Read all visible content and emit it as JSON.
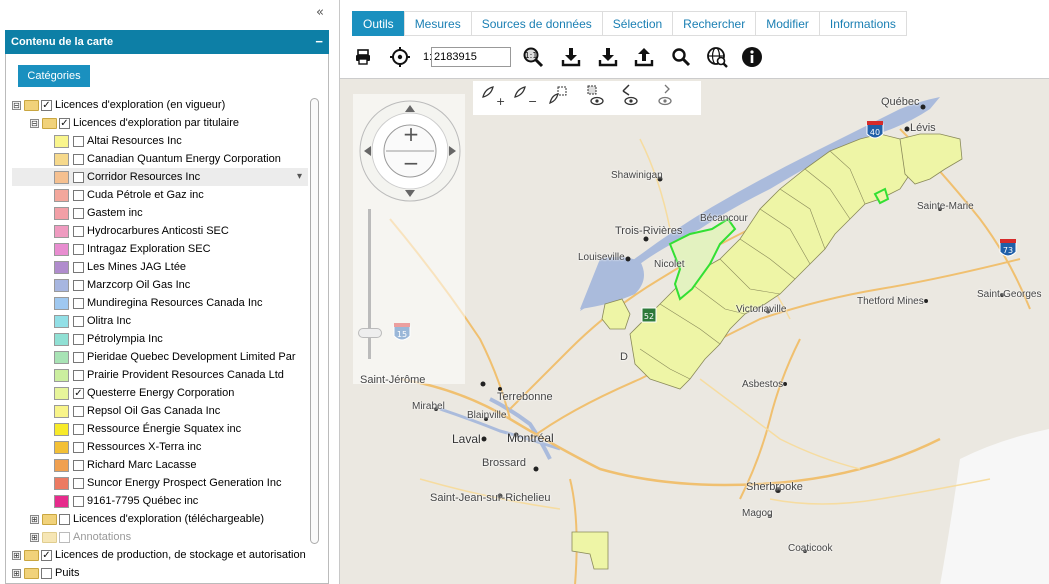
{
  "left_panel": {
    "collapse_icon": "«",
    "title": "Contenu de la carte",
    "minimize_icon": "−",
    "categories_tab": "Catégories",
    "tree": [
      {
        "expander": "⊟",
        "folder": true,
        "checked": true,
        "label": "Licences d'exploration (en vigueur)",
        "indent": 0
      },
      {
        "expander": "⊟",
        "folder": true,
        "checked": true,
        "label": "Licences d'exploration par titulaire",
        "indent": 1
      },
      {
        "swatch": "#f9f58d",
        "checked": false,
        "label": "Altai Resources Inc",
        "indent": 2
      },
      {
        "swatch": "#f6d98c",
        "checked": false,
        "label": "Canadian Quantum Energy Corporation",
        "indent": 2
      },
      {
        "swatch": "#f5c090",
        "checked": false,
        "label": "Corridor Resources Inc",
        "indent": 2,
        "highlight": true,
        "menu": "▾"
      },
      {
        "swatch": "#f3a79c",
        "checked": false,
        "label": "Cuda Pétrole et Gaz inc",
        "indent": 2
      },
      {
        "swatch": "#f29fa6",
        "checked": false,
        "label": "Gastem inc",
        "indent": 2
      },
      {
        "swatch": "#ef9bc0",
        "checked": false,
        "label": "Hydrocarbures Anticosti SEC",
        "indent": 2
      },
      {
        "swatch": "#e88dd0",
        "checked": false,
        "label": "Intragaz Exploration SEC",
        "indent": 2
      },
      {
        "swatch": "#b08ccd",
        "checked": false,
        "label": "Les Mines JAG Ltée",
        "indent": 2
      },
      {
        "swatch": "#a7b6e0",
        "checked": false,
        "label": "Marzcorp Oil Gas Inc",
        "indent": 2
      },
      {
        "swatch": "#9fc8f0",
        "checked": false,
        "label": "Mundiregina Resources Canada Inc",
        "indent": 2
      },
      {
        "swatch": "#92dfe6",
        "checked": false,
        "label": "Olitra Inc",
        "indent": 2
      },
      {
        "swatch": "#90e0d4",
        "checked": false,
        "label": "Pétrolympia Inc",
        "indent": 2
      },
      {
        "swatch": "#a8e3b5",
        "checked": false,
        "label": "Pieridae Quebec Development Limited Par",
        "indent": 2
      },
      {
        "swatch": "#cbee9f",
        "checked": false,
        "label": "Prairie Provident Resources Canada Ltd",
        "indent": 2
      },
      {
        "swatch": "#e7f59a",
        "checked": true,
        "label": "Questerre Energy Corporation",
        "indent": 2
      },
      {
        "swatch": "#f8f48a",
        "checked": false,
        "label": "Repsol Oil Gas Canada Inc",
        "indent": 2
      },
      {
        "swatch": "#f7ea2a",
        "checked": false,
        "label": "Ressource Énergie Squatex inc",
        "indent": 2
      },
      {
        "swatch": "#f3c036",
        "checked": false,
        "label": "Ressources X-Terra inc",
        "indent": 2
      },
      {
        "swatch": "#f0a050",
        "checked": false,
        "label": "Richard Marc Lacasse",
        "indent": 2
      },
      {
        "swatch": "#ec7a62",
        "checked": false,
        "label": "Suncor Energy Prospect Generation Inc",
        "indent": 2
      },
      {
        "swatch": "#e62b8c",
        "checked": false,
        "label": "9161-7795 Québec inc",
        "indent": 2
      },
      {
        "expander": "⊞",
        "folder": true,
        "checked": false,
        "label": "Licences d'exploration (téléchargeable)",
        "indent": 1
      },
      {
        "expander": "⊞",
        "folder": true,
        "dim": true,
        "checked": false,
        "label": "Annotations",
        "indent": 1,
        "gray": true
      },
      {
        "expander": "⊞",
        "folder": true,
        "checked": true,
        "label": "Licences de production, de stockage et autorisation",
        "indent": 0
      },
      {
        "expander": "⊞",
        "folder": true,
        "checked": false,
        "label": "Puits",
        "indent": 0
      }
    ]
  },
  "tabs": [
    {
      "label": "Outils",
      "active": true
    },
    {
      "label": "Mesures"
    },
    {
      "label": "Sources de données"
    },
    {
      "label": "Sélection"
    },
    {
      "label": "Rechercher"
    },
    {
      "label": "Modifier"
    },
    {
      "label": "Informations"
    }
  ],
  "toolbar": {
    "icons": [
      "printer-icon",
      "locate-icon",
      "zoom-scale-icon",
      "download-icon",
      "download-alt-icon",
      "upload-icon",
      "search-icon",
      "globe-search-icon",
      "info-icon"
    ],
    "scale_prefix": "1:",
    "scale_value": "2183915"
  },
  "map": {
    "zoom_plus": "+",
    "zoom_minus": "−",
    "cities": [
      {
        "name": "Québec",
        "cls": "mid"
      },
      {
        "name": "Lévis",
        "cls": "mid"
      },
      {
        "name": "Shawinigan",
        "cls": ""
      },
      {
        "name": "Bécancour",
        "cls": ""
      },
      {
        "name": "Sainte-Marie",
        "cls": ""
      },
      {
        "name": "Trois-Rivières",
        "cls": "mid"
      },
      {
        "name": "Louiseville",
        "cls": ""
      },
      {
        "name": "Nicolet",
        "cls": ""
      },
      {
        "name": "Victoriaville",
        "cls": ""
      },
      {
        "name": "Thetford Mines",
        "cls": ""
      },
      {
        "name": "Saint-Georges",
        "cls": ""
      },
      {
        "name": "D",
        "cls": "mid"
      },
      {
        "name": "Saint-Jérôme",
        "cls": "mid"
      },
      {
        "name": "Asbestos",
        "cls": ""
      },
      {
        "name": "Terrebonne",
        "cls": "mid"
      },
      {
        "name": "Mirabel",
        "cls": ""
      },
      {
        "name": "Blainville",
        "cls": ""
      },
      {
        "name": "Laval",
        "cls": "big"
      },
      {
        "name": "Montréal",
        "cls": "big"
      },
      {
        "name": "Brossard",
        "cls": "mid"
      },
      {
        "name": "Sherbrooke",
        "cls": "mid"
      },
      {
        "name": "Magog",
        "cls": ""
      },
      {
        "name": "Saint-Jean-sur-Richelieu",
        "cls": "mid"
      },
      {
        "name": "Coaticook",
        "cls": ""
      }
    ],
    "shields": [
      {
        "num": "40"
      },
      {
        "num": "73"
      },
      {
        "num": "15"
      },
      {
        "num": "52"
      }
    ]
  },
  "colors": {
    "accent": "#1a90bf",
    "panel_header": "#0d7fa6",
    "license_fill": "#eef5a6",
    "license_stroke": "#8a8a5a",
    "selected_outline": "#33e033",
    "water": "#aabbdc"
  }
}
